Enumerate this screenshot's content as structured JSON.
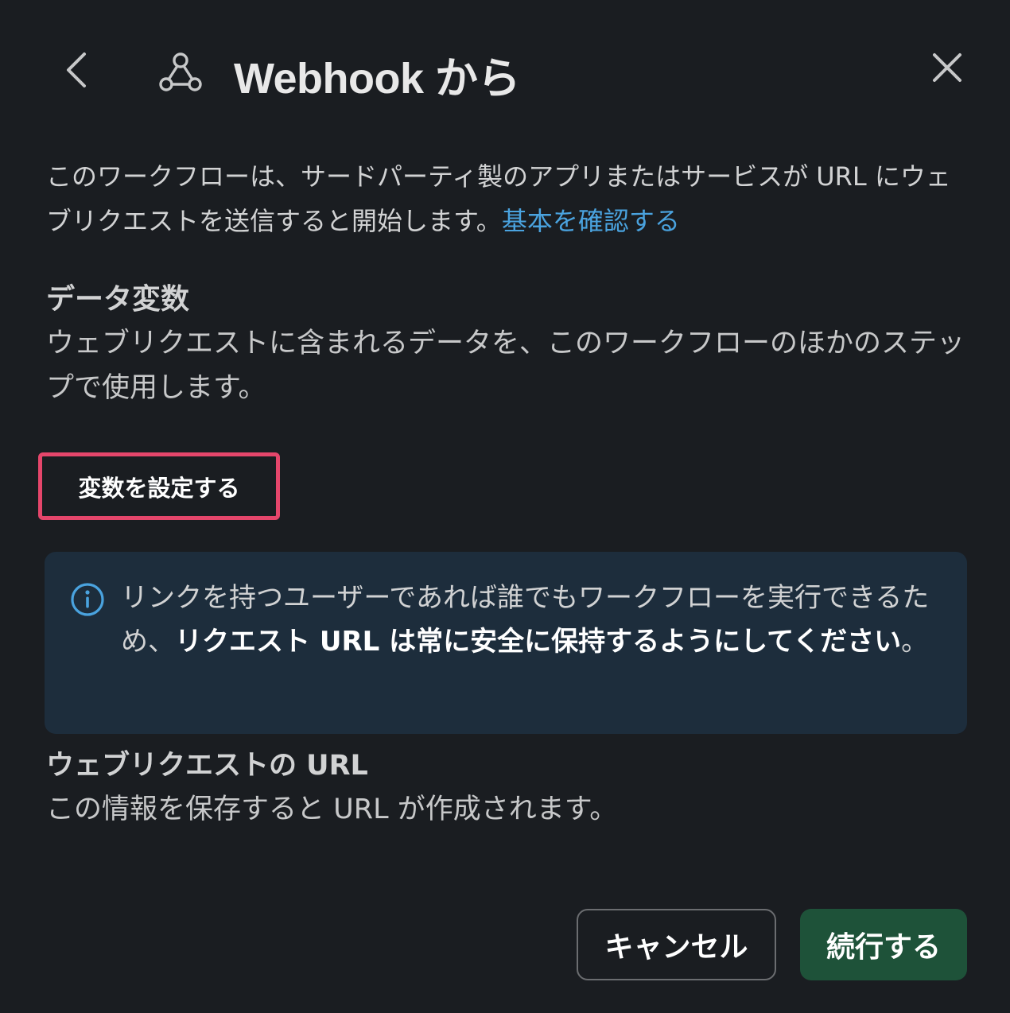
{
  "header": {
    "title": "Webhook から",
    "back_icon": "chevron-left-icon",
    "webhook_icon": "webhook-icon",
    "close_icon": "close-icon"
  },
  "description": {
    "text": "このワークフローは、サードパーティ製のアプリまたはサービスが URL にウェブリクエストを送信すると開始します。",
    "link": "基本を確認する"
  },
  "data_variables": {
    "title": "データ変数",
    "description": "ウェブリクエストに含まれるデータを、このワークフローのほかのステップで使用します。",
    "button_label": "変数を設定する"
  },
  "info_box": {
    "icon": "info-icon",
    "text_normal": "リンクを持つユーザーであれば誰でもワークフローを実行できるため、",
    "text_bold": "リクエスト URL は常に安全に保持するようにしてください",
    "text_end": "。"
  },
  "webhook_url": {
    "title": "ウェブリクエストの URL",
    "description": "この情報を保存すると URL が作成されます。"
  },
  "footer": {
    "cancel_label": "キャンセル",
    "continue_label": "続行する"
  },
  "colors": {
    "background": "#1a1d21",
    "link": "#4aa3df",
    "highlight_border": "#e5466b",
    "info_bg": "#1d2d3c",
    "primary_button": "#1e5239"
  }
}
